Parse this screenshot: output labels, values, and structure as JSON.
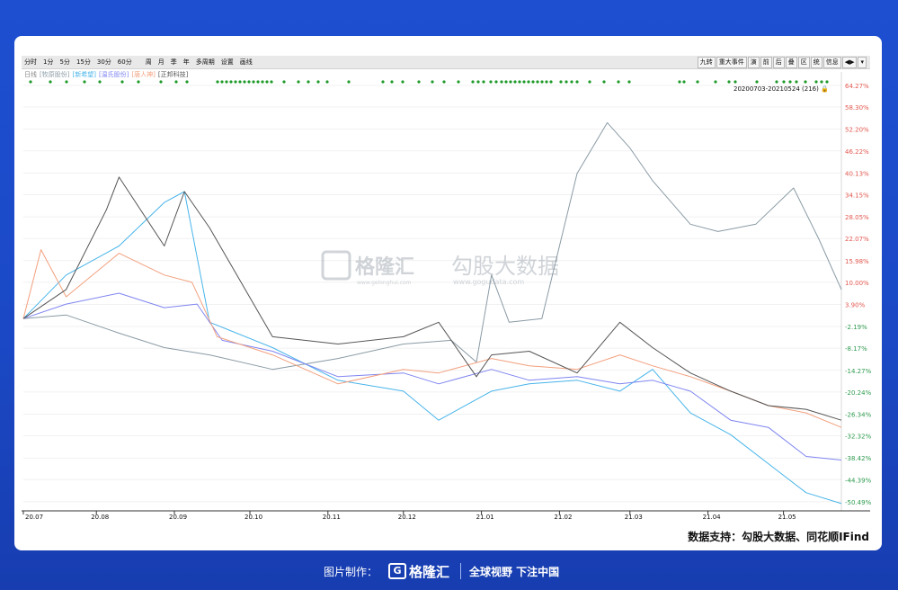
{
  "toolbar": {
    "left_items": [
      "分时",
      "1分",
      "5分",
      "15分",
      "30分",
      "60分",
      "周",
      "月",
      "季",
      "年",
      "多周期",
      "设置",
      "画线"
    ],
    "right_items": [
      "九转",
      "重大事件",
      "演",
      "前",
      "后",
      "叠",
      "区",
      "统",
      "信息",
      "◀▶",
      "▾"
    ]
  },
  "legend": {
    "prefix": "日线",
    "stocks": [
      "牧原股份",
      "新希望",
      "温氏股份",
      "唐人神",
      "正邦科技"
    ]
  },
  "range_label": "20200703-20210524 (216)",
  "source": "数据支持：勾股大数据、同花顺IFind",
  "watermark": {
    "brand": "格隆汇",
    "site": "www.gelonghui.com",
    "name": "勾股大数据",
    "url": "www.gogudata.com"
  },
  "footer": {
    "made_by": "图片制作：",
    "brand": "格隆汇",
    "slogan": "全球视野 下注中国"
  },
  "chart_data": {
    "type": "line",
    "x_ticks": [
      "20.07",
      "20.08",
      "20.09",
      "20.10",
      "20.11",
      "20.12",
      "21.01",
      "21.02",
      "21.03",
      "21.04",
      "21.05"
    ],
    "y_ticks": [
      "64.27%",
      "58.30%",
      "52.20%",
      "46.22%",
      "40.13%",
      "34.15%",
      "28.05%",
      "22.07%",
      "15.98%",
      "10.00%",
      "3.90%",
      "-2.19%",
      "-8.17%",
      "-14.27%",
      "-20.24%",
      "-26.34%",
      "-32.32%",
      "-38.42%",
      "-44.39%",
      "-50.49%"
    ],
    "ylim": [
      -53,
      66
    ],
    "x_range": [
      "2020-07-03",
      "2021-05-24"
    ],
    "series": [
      {
        "name": "牧原股份",
        "color": "#8a9ba5",
        "points": [
          [
            "2020-07-03",
            0
          ],
          [
            "2020-07-20",
            1
          ],
          [
            "2020-08-10",
            -4
          ],
          [
            "2020-08-28",
            -8
          ],
          [
            "2020-09-15",
            -10
          ],
          [
            "2020-10-10",
            -14
          ],
          [
            "2020-11-05",
            -11
          ],
          [
            "2020-12-01",
            -7
          ],
          [
            "2020-12-20",
            -6
          ],
          [
            "2020-12-30",
            -12
          ],
          [
            "2021-01-05",
            12
          ],
          [
            "2021-01-12",
            -1
          ],
          [
            "2021-01-25",
            0
          ],
          [
            "2021-02-08",
            40
          ],
          [
            "2021-02-20",
            54
          ],
          [
            "2021-03-01",
            47
          ],
          [
            "2021-03-10",
            38
          ],
          [
            "2021-03-25",
            26
          ],
          [
            "2021-04-05",
            24
          ],
          [
            "2021-04-20",
            26
          ],
          [
            "2021-05-05",
            36
          ],
          [
            "2021-05-15",
            22
          ],
          [
            "2021-05-24",
            8
          ]
        ]
      },
      {
        "name": "新希望",
        "color": "#48b4ea",
        "points": [
          [
            "2020-07-03",
            0
          ],
          [
            "2020-07-20",
            12
          ],
          [
            "2020-08-10",
            20
          ],
          [
            "2020-08-28",
            32
          ],
          [
            "2020-09-05",
            35
          ],
          [
            "2020-09-15",
            -1
          ],
          [
            "2020-10-10",
            -8
          ],
          [
            "2020-11-05",
            -17
          ],
          [
            "2020-12-01",
            -20
          ],
          [
            "2020-12-15",
            -28
          ],
          [
            "2021-01-05",
            -20
          ],
          [
            "2021-01-20",
            -18
          ],
          [
            "2021-02-08",
            -17
          ],
          [
            "2021-02-25",
            -20
          ],
          [
            "2021-03-10",
            -14
          ],
          [
            "2021-03-25",
            -26
          ],
          [
            "2021-04-10",
            -32
          ],
          [
            "2021-04-25",
            -40
          ],
          [
            "2021-05-10",
            -48
          ],
          [
            "2021-05-24",
            -51
          ]
        ]
      },
      {
        "name": "温氏股份",
        "color": "#7f85f0",
        "points": [
          [
            "2020-07-03",
            0
          ],
          [
            "2020-07-20",
            4
          ],
          [
            "2020-08-10",
            7
          ],
          [
            "2020-08-28",
            3
          ],
          [
            "2020-09-10",
            4
          ],
          [
            "2020-09-20",
            -6
          ],
          [
            "2020-10-10",
            -9
          ],
          [
            "2020-11-05",
            -16
          ],
          [
            "2020-12-01",
            -15
          ],
          [
            "2020-12-15",
            -18
          ],
          [
            "2021-01-05",
            -14
          ],
          [
            "2021-01-20",
            -17
          ],
          [
            "2021-02-08",
            -16
          ],
          [
            "2021-02-25",
            -18
          ],
          [
            "2021-03-10",
            -17
          ],
          [
            "2021-03-25",
            -20
          ],
          [
            "2021-04-10",
            -28
          ],
          [
            "2021-04-25",
            -30
          ],
          [
            "2021-05-10",
            -38
          ],
          [
            "2021-05-24",
            -39
          ]
        ]
      },
      {
        "name": "唐人神",
        "color": "#f2a07e",
        "points": [
          [
            "2020-07-03",
            0
          ],
          [
            "2020-07-10",
            19
          ],
          [
            "2020-07-20",
            6
          ],
          [
            "2020-08-10",
            18
          ],
          [
            "2020-08-28",
            12
          ],
          [
            "2020-09-08",
            10
          ],
          [
            "2020-09-18",
            -5
          ],
          [
            "2020-10-10",
            -10
          ],
          [
            "2020-11-05",
            -18
          ],
          [
            "2020-12-01",
            -14
          ],
          [
            "2020-12-15",
            -15
          ],
          [
            "2021-01-05",
            -11
          ],
          [
            "2021-01-20",
            -13
          ],
          [
            "2021-02-08",
            -14
          ],
          [
            "2021-02-25",
            -10
          ],
          [
            "2021-03-10",
            -13
          ],
          [
            "2021-03-25",
            -16
          ],
          [
            "2021-04-10",
            -20
          ],
          [
            "2021-04-25",
            -24
          ],
          [
            "2021-05-10",
            -26
          ],
          [
            "2021-05-24",
            -30
          ]
        ]
      },
      {
        "name": "正邦科技",
        "color": "#555555",
        "points": [
          [
            "2020-07-03",
            0
          ],
          [
            "2020-07-20",
            8
          ],
          [
            "2020-08-05",
            30
          ],
          [
            "2020-08-10",
            39
          ],
          [
            "2020-08-28",
            20
          ],
          [
            "2020-09-05",
            35
          ],
          [
            "2020-09-15",
            25
          ],
          [
            "2020-10-10",
            -5
          ],
          [
            "2020-11-05",
            -7
          ],
          [
            "2020-12-01",
            -5
          ],
          [
            "2020-12-15",
            -1
          ],
          [
            "2020-12-30",
            -16
          ],
          [
            "2021-01-05",
            -10
          ],
          [
            "2021-01-20",
            -9
          ],
          [
            "2021-02-08",
            -15
          ],
          [
            "2021-02-25",
            -1
          ],
          [
            "2021-03-10",
            -8
          ],
          [
            "2021-03-25",
            -15
          ],
          [
            "2021-04-10",
            -20
          ],
          [
            "2021-04-25",
            -24
          ],
          [
            "2021-05-10",
            -25
          ],
          [
            "2021-05-24",
            -28
          ]
        ]
      }
    ]
  }
}
